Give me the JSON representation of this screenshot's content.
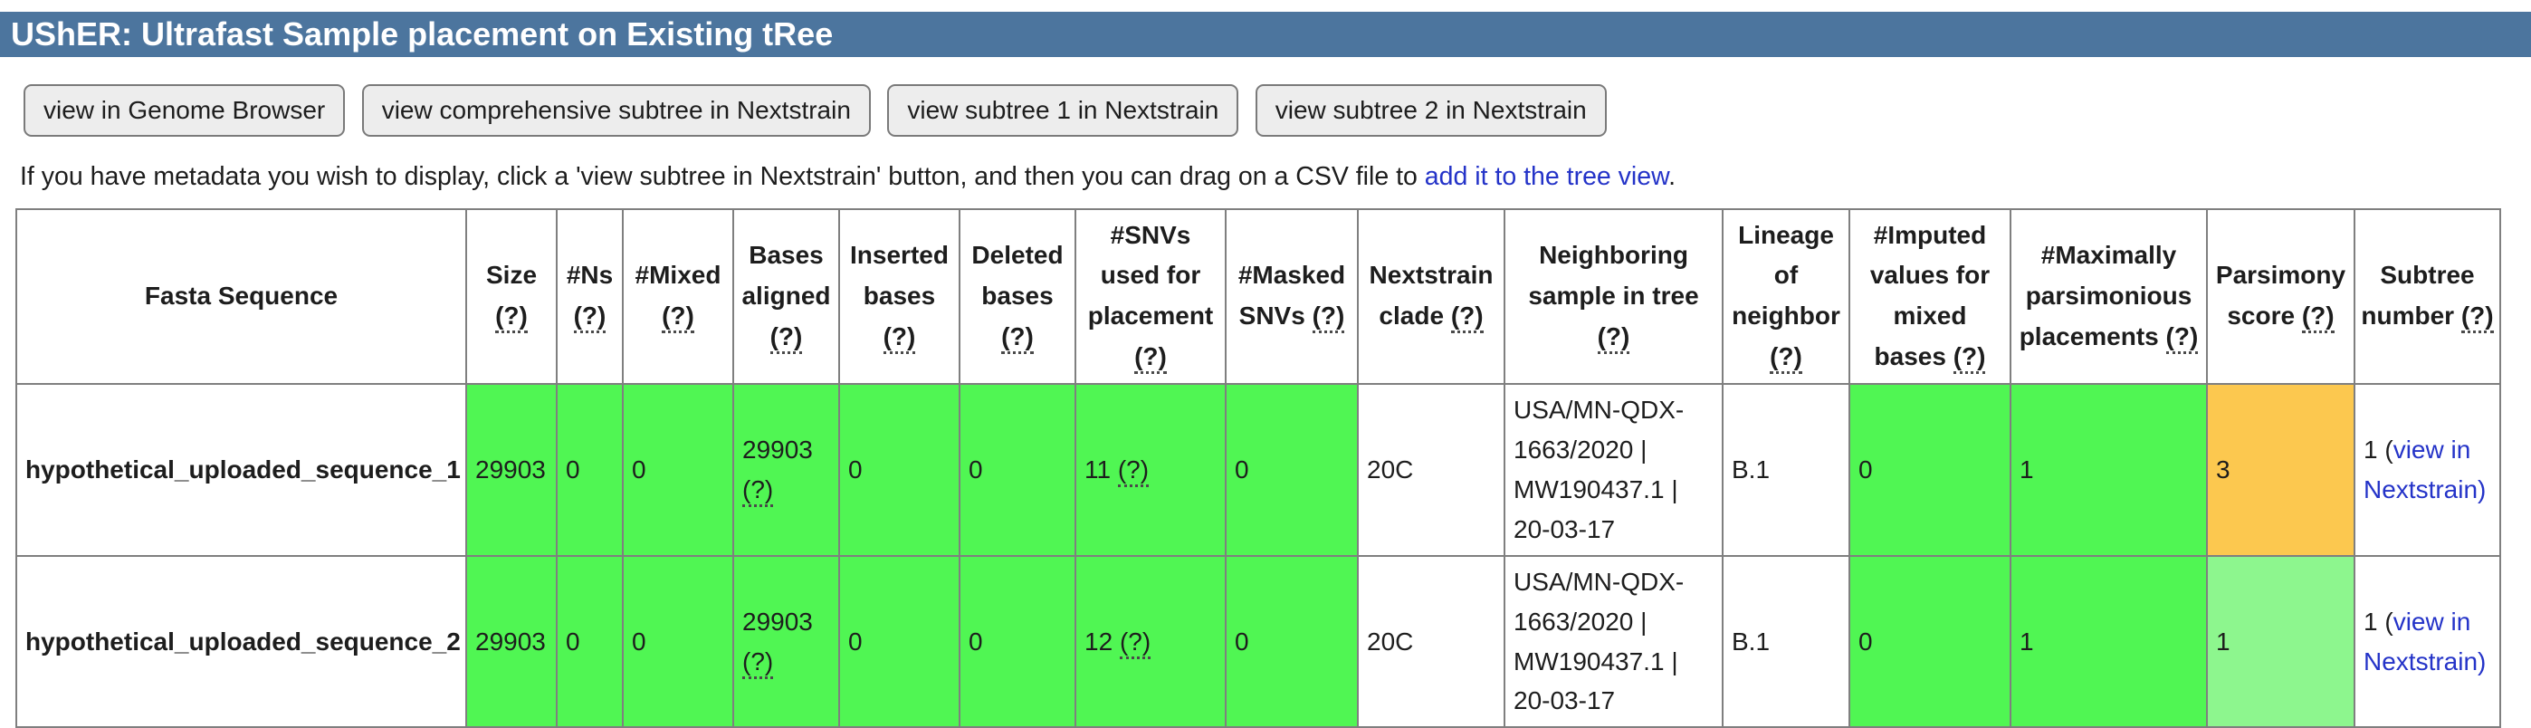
{
  "header": {
    "title": "UShER: Ultrafast Sample placement on Existing tRee"
  },
  "toolbar": {
    "buttons": [
      "view in Genome Browser",
      "view comprehensive subtree in Nextstrain",
      "view subtree 1 in Nextstrain",
      "view subtree 2 in Nextstrain"
    ]
  },
  "note": {
    "text_before_link": "If you have metadata you wish to display, click a 'view subtree in Nextstrain' button, and then you can drag on a CSV file to ",
    "link_label": "add it to the tree view",
    "text_after_link": "."
  },
  "colors": {
    "header_bar": "#4c759e",
    "cell_green": "#50f653",
    "cell_orange": "#fcc84f",
    "cell_light_green": "#8df68e",
    "link_blue": "#2433c8"
  },
  "table": {
    "columns": [
      {
        "label": "Fasta Sequence",
        "help": ""
      },
      {
        "label": "Size",
        "help": "(?)"
      },
      {
        "label": "#Ns",
        "help": "(?)"
      },
      {
        "label": "#Mixed",
        "help": "(?)"
      },
      {
        "label": "Bases aligned",
        "help": "(?)"
      },
      {
        "label": "Inserted bases",
        "help": "(?)"
      },
      {
        "label": "Deleted bases",
        "help": "(?)"
      },
      {
        "label": "#SNVs used for placement",
        "help": "(?)"
      },
      {
        "label": "#Masked SNVs",
        "help": "(?)"
      },
      {
        "label": "Nextstrain clade",
        "help": "(?)"
      },
      {
        "label": "Neighboring sample in tree",
        "help": "(?)"
      },
      {
        "label": "Lineage of neighbor",
        "help": "(?)"
      },
      {
        "label": "#Imputed values for mixed bases",
        "help": "(?)"
      },
      {
        "label": "#Maximally parsimonious placements",
        "help": "(?)"
      },
      {
        "label": "Parsimony score",
        "help": "(?)"
      },
      {
        "label": "Subtree number",
        "help": "(?)"
      }
    ],
    "rows": [
      {
        "name": "hypothetical_uploaded_sequence_1",
        "size": "29903",
        "ns": "0",
        "mixed": "0",
        "bases_aligned": "29903",
        "bases_aligned_help": "(?)",
        "inserted_bases": "0",
        "deleted_bases": "0",
        "snvs_used": "11",
        "snvs_used_help": "(?)",
        "masked_snvs": "0",
        "nextstrain_clade": "20C",
        "neighboring_sample": "USA/MN-QDX-1663/2020 | MW190437.1 | 20-03-17",
        "lineage": "B.1",
        "imputed": "0",
        "max_parsimonious_placements": "1",
        "parsimony_score": "3",
        "subtree": {
          "prefix": "1 (",
          "link": "view in Nextstrain",
          "suffix": ")"
        }
      },
      {
        "name": "hypothetical_uploaded_sequence_2",
        "size": "29903",
        "ns": "0",
        "mixed": "0",
        "bases_aligned": "29903",
        "bases_aligned_help": "(?)",
        "inserted_bases": "0",
        "deleted_bases": "0",
        "snvs_used": "12",
        "snvs_used_help": "(?)",
        "masked_snvs": "0",
        "nextstrain_clade": "20C",
        "neighboring_sample": "USA/MN-QDX-1663/2020 | MW190437.1 | 20-03-17",
        "lineage": "B.1",
        "imputed": "0",
        "max_parsimonious_placements": "1",
        "parsimony_score": "1",
        "subtree": {
          "prefix": "1 (",
          "link": "view in Nextstrain",
          "suffix": ")"
        }
      }
    ]
  }
}
